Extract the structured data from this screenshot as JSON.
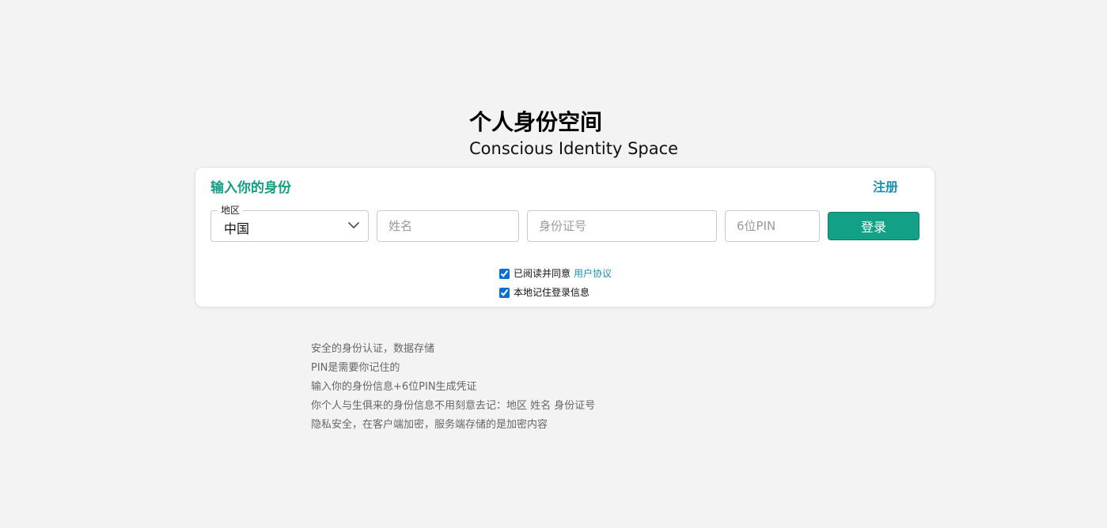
{
  "header": {
    "title": "个人身份空间",
    "subtitle": "Conscious Identity Space"
  },
  "card": {
    "title": "输入你的身份",
    "register_label": "注册",
    "region": {
      "legend": "地区",
      "value": "中国"
    },
    "name_placeholder": "姓名",
    "id_placeholder": "身份证号",
    "pin_placeholder": "6位PIN",
    "login_label": "登录",
    "agree": {
      "checked": true,
      "text": "已阅读并同意",
      "link": "用户协议"
    },
    "remember": {
      "checked": true,
      "text": "本地记住登录信息"
    }
  },
  "info": {
    "lines": [
      "安全的身份认证，数据存储",
      "PIN是需要你记住的",
      "输入你的身份信息+6位PIN生成凭证",
      "你个人与生俱来的身份信息不用刻意去记：地区 姓名 身份证号",
      "隐私安全，在客户端加密，服务端存储的是加密内容"
    ]
  },
  "colors": {
    "accent": "#149f83",
    "button": "#12a086",
    "link": "#1a8fb3",
    "checkbox": "#0b6fd6",
    "background": "#f3f3f3"
  },
  "icons": {
    "region_dropdown": "chevron-down-icon"
  }
}
